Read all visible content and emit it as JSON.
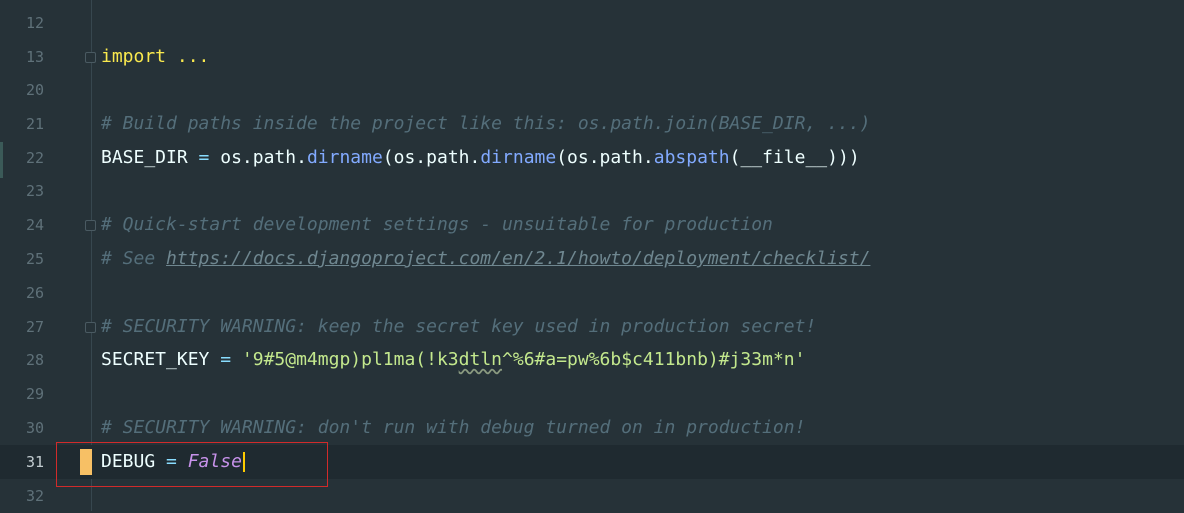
{
  "editor": {
    "lines": [
      {
        "num": "12"
      },
      {
        "num": "13",
        "text": "import ..."
      },
      {
        "num": "20"
      },
      {
        "num": "21",
        "text": "# Build paths inside the project like this: os.path.join(BASE_DIR, ...)"
      },
      {
        "num": "22",
        "parts": {
          "a": "BASE_DIR ",
          "eq": "=",
          "b": " os.path.",
          "fn1": "dirname",
          "c": "(os.path.",
          "fn2": "dirname",
          "d": "(os.path.",
          "fn3": "abspath",
          "e": "(__file__)))"
        }
      },
      {
        "num": "23"
      },
      {
        "num": "24",
        "text": "# Quick-start development settings - unsuitable for production"
      },
      {
        "num": "25",
        "prefix": "# See ",
        "link": "https://docs.djangoproject.com/en/2.1/howto/deployment/checklist/"
      },
      {
        "num": "26"
      },
      {
        "num": "27",
        "text": "# SECURITY WARNING: keep the secret key used in production secret!"
      },
      {
        "num": "28",
        "parts": {
          "a": "SECRET_KEY ",
          "eq": "=",
          "sp": " ",
          "str1": "'9#5@m4mgp)pl1ma(!k3",
          "sq": "dtln",
          "str2": "^%6#a=pw%6b$c411bnb)#j33m*n'"
        }
      },
      {
        "num": "29"
      },
      {
        "num": "30",
        "text": "# SECURITY WARNING: don't run with debug turned on in production!"
      },
      {
        "num": "31",
        "parts": {
          "a": "DEBUG ",
          "eq": "=",
          "sp": " ",
          "val": "False"
        }
      },
      {
        "num": "32"
      }
    ]
  },
  "colors": {
    "background": "#263238",
    "keyword": "#f9e94e",
    "comment": "#546e7a",
    "function": "#82aaff",
    "string": "#c3e88d",
    "boolean": "#c792ea",
    "highlight_box": "#d12b2b",
    "bookmark": "#f7c065"
  }
}
